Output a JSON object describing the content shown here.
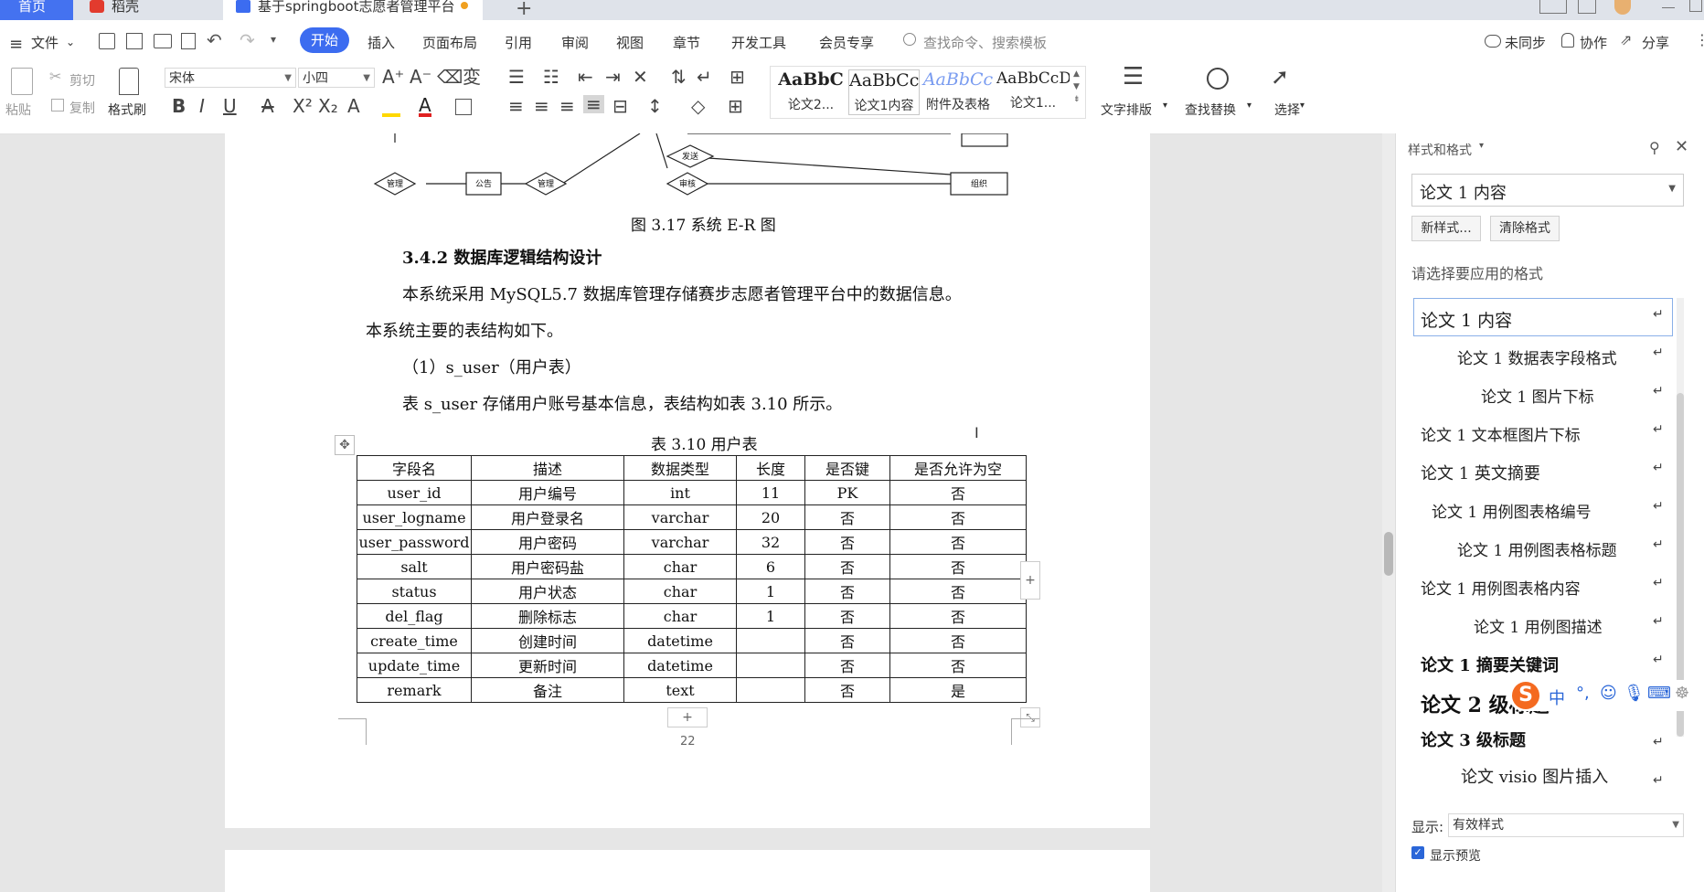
{
  "tabs": {
    "home": "首页",
    "daoke": "稻壳",
    "doc": "基于springboot志愿者管理平台"
  },
  "menu": {
    "file": "文件",
    "start": "开始",
    "insert": "插入",
    "layout": "页面布局",
    "ref": "引用",
    "review": "审阅",
    "view": "视图",
    "chapter": "章节",
    "dev": "开发工具",
    "member": "会员专享",
    "search_placeholder": "查找命令、搜索模板",
    "sync": "未同步",
    "collab": "协作",
    "share": "分享"
  },
  "ribbon": {
    "paste": "粘贴",
    "cut": "剪切",
    "copy": "复制",
    "format_painter": "格式刷",
    "font": "宋体",
    "size": "小四",
    "styles": [
      {
        "sample": "AaBbC",
        "caption": "论文2..."
      },
      {
        "sample": "AaBbCcI",
        "caption": "论文1内容"
      },
      {
        "sample": "AaBbCc",
        "caption": "附件及表格"
      },
      {
        "sample": "AaBbCcD",
        "caption": "论文1..."
      }
    ],
    "text_layout": "文字排版",
    "find_replace": "查找替换",
    "select": "选择"
  },
  "doc": {
    "er_labels": [
      "管理",
      "公告",
      "管理",
      "审核",
      "发送",
      "组织"
    ],
    "fig_caption": "图 3.17  系统 E-R 图",
    "heading": "3.4.2    数据库逻辑结构设计",
    "para1a": "本系统采用 MySQL5.7 数据库管理存储赛步志愿者管理平台中的数据信息。",
    "para1b": "本系统主要的表结构如下。",
    "sub1": "（1）s_user（用户表）",
    "para2": "表 s_user 存储用户账号基本信息，表结构如表 3.10 所示。",
    "table_caption": "表 3.10  用户表",
    "table_header": [
      "字段名",
      "描述",
      "数据类型",
      "长度",
      "是否键",
      "是否允许为空"
    ],
    "table_rows": [
      [
        "user_id",
        "用户编号",
        "int",
        "11",
        "PK",
        "否"
      ],
      [
        "user_logname",
        "用户登录名",
        "varchar",
        "20",
        "否",
        "否"
      ],
      [
        "user_password",
        "用户密码",
        "varchar",
        "32",
        "否",
        "否"
      ],
      [
        "salt",
        "用户密码盐",
        "char",
        "6",
        "否",
        "否"
      ],
      [
        "status",
        "用户状态",
        "char",
        "1",
        "否",
        "否"
      ],
      [
        "del_flag",
        "删除标志",
        "char",
        "1",
        "否",
        "否"
      ],
      [
        "create_time",
        "创建时间",
        "datetime",
        "",
        "否",
        "否"
      ],
      [
        "update_time",
        "更新时间",
        "datetime",
        "",
        "否",
        "否"
      ],
      [
        "remark",
        "备注",
        "text",
        "",
        "否",
        "是"
      ]
    ],
    "page_number": "22"
  },
  "pane": {
    "title": "样式和格式",
    "current_style": "论文 1 内容",
    "new_style": "新样式...",
    "clear_format": "清除格式",
    "prompt": "请选择要应用的格式",
    "items": [
      "论文 1 内容",
      "论文 1 数据表字段格式",
      "论文 1 图片下标",
      "论文 1 文本框图片下标",
      "论文 1 英文摘要",
      "论文 1 用例图表格编号",
      "论文 1 用例图表格标题",
      "论文 1 用例图表格内容",
      "论文 1 用例图描述",
      "论文 1 摘要关键词",
      "论文 2 级标题",
      "论文 3 级标题",
      "论文 visio 图片插入"
    ],
    "show_label": "显示:",
    "show_value": "有效样式",
    "preview": "显示预览"
  },
  "ime": {
    "lang": "中"
  },
  "colors": {
    "accent": "#3c6cf0",
    "page": "#ffffff",
    "workspace": "#e6e6e6"
  }
}
